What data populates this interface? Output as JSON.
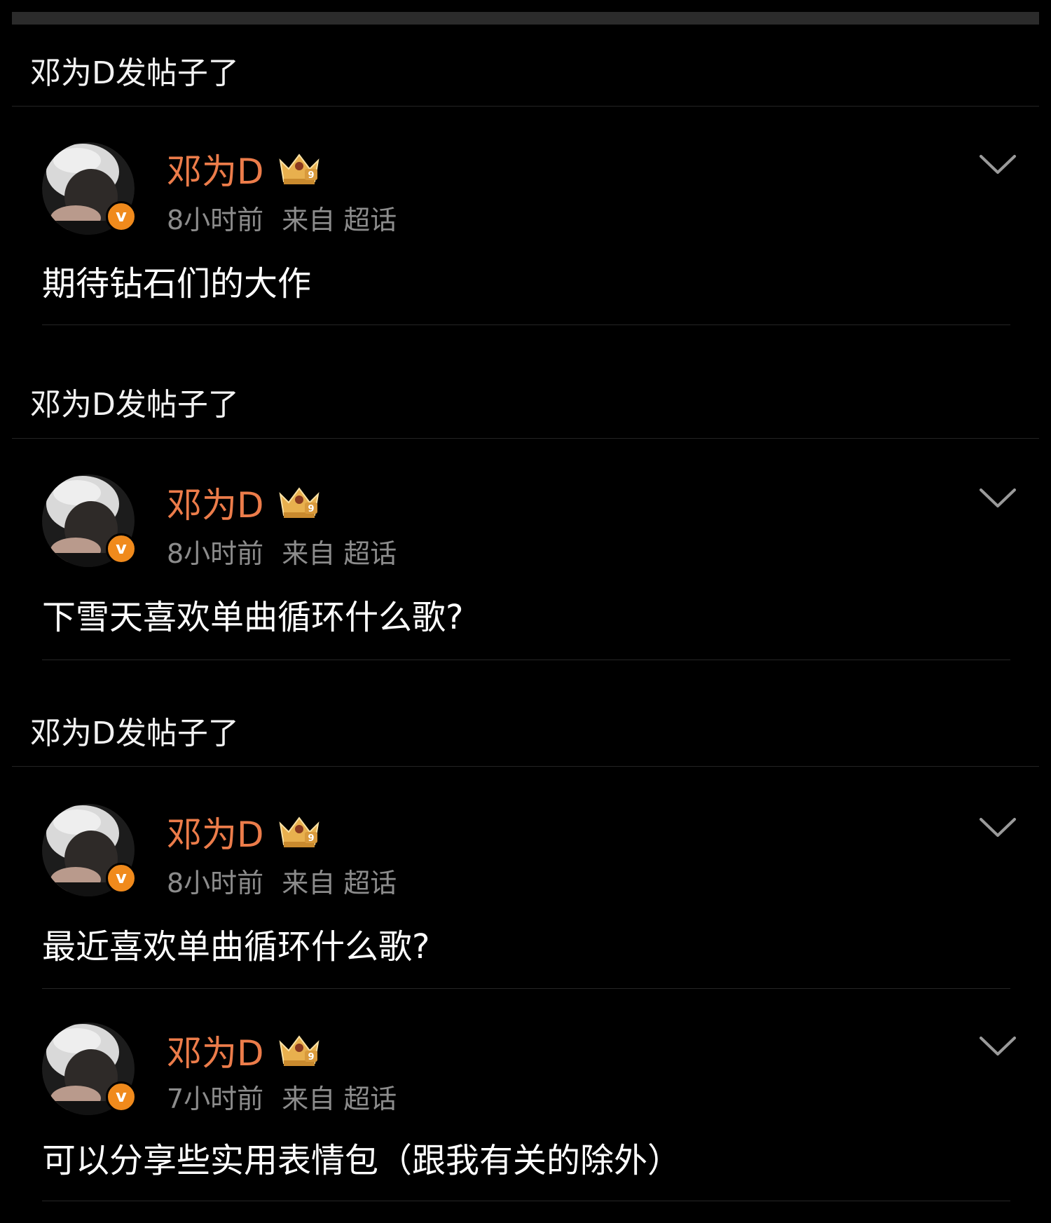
{
  "sections": [
    {
      "header": "邓为D发帖子了",
      "post": {
        "username": "邓为D",
        "time": "8小时前",
        "source_prefix": "来自",
        "source": "超话",
        "text": "期待钻石们的大作"
      }
    },
    {
      "header": "邓为D发帖子了",
      "post": {
        "username": "邓为D",
        "time": "8小时前",
        "source_prefix": "来自",
        "source": "超话",
        "text": "下雪天喜欢单曲循环什么歌?"
      }
    },
    {
      "header": "邓为D发帖子了",
      "post": {
        "username": "邓为D",
        "time": "8小时前",
        "source_prefix": "来自",
        "source": "超话",
        "text": "最近喜欢单曲循环什么歌?"
      }
    },
    {
      "post": {
        "username": "邓为D",
        "time": "7小时前",
        "source_prefix": "来自",
        "source": "超话",
        "text": "可以分享些实用表情包（跟我有关的除外）"
      }
    }
  ],
  "badge_letter": "v",
  "colors": {
    "username": "#ec7c4a",
    "verified": "#f08a1c",
    "meta": "#8c8c8c",
    "background": "#000000"
  },
  "icons": {
    "verified": "verified-v-icon",
    "crown": "crown-level-9-icon",
    "more": "chevron-down-icon"
  }
}
